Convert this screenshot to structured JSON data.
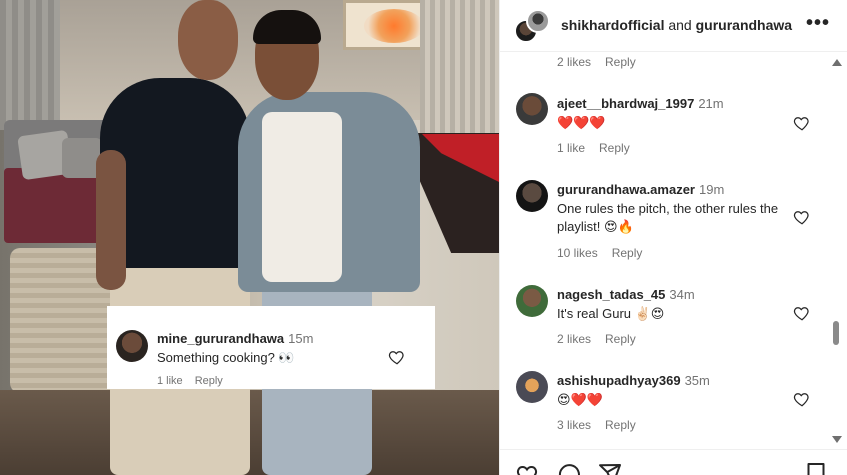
{
  "overlay": {
    "username": "mine_gururandhawa",
    "time": "15m",
    "text": "Something cooking? 👀",
    "likes": "1 like",
    "reply": "Reply"
  },
  "header": {
    "account": "shikhardofficial",
    "joiner": "and",
    "collaborator": "gururandhawa",
    "more": "•••"
  },
  "comments": {
    "prev_likes": "2 likes",
    "prev_reply": "Reply",
    "items": [
      {
        "username": "ajeet__bhardwaj_1997",
        "time": "21m",
        "text": "❤️❤️❤️",
        "likes": "1 like",
        "reply": "Reply"
      },
      {
        "username": "gururandhawa.amazer",
        "time": "19m",
        "text": "One rules the pitch, the other rules the playlist! 😍🔥",
        "likes": "10 likes",
        "reply": "Reply"
      },
      {
        "username": "nagesh_tadas_45",
        "time": "34m",
        "text": "It's real Guru ✌🏻😍",
        "likes": "2 likes",
        "reply": "Reply"
      },
      {
        "username": "ashishupadhyay369",
        "time": "35m",
        "text": "😍❤️❤️",
        "likes": "3 likes",
        "reply": "Reply"
      }
    ]
  },
  "icons": {
    "heart": "heart-icon",
    "comment": "comment-icon",
    "share": "share-icon",
    "save": "bookmark-icon"
  },
  "colors": {
    "text": "#262626",
    "secondary": "#737373",
    "border": "#efefef"
  }
}
